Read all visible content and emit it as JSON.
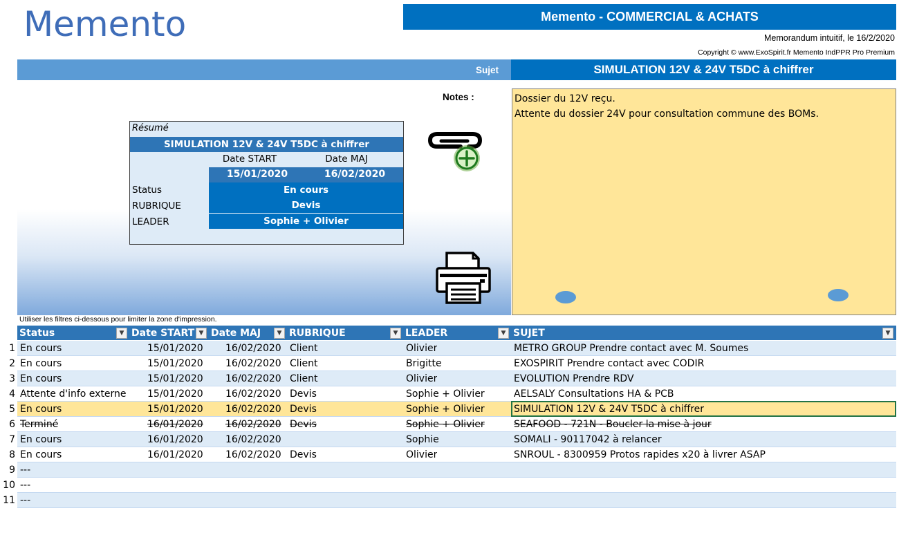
{
  "logo": "Memento",
  "app_title": "Memento - COMMERCIAL & ACHATS",
  "memo_date": "Memorandum intuitif, le 16/2/2020",
  "copyright": "Copyright © www.ExoSpirit.fr Memento IndPPR Pro Premium",
  "sujet": {
    "label": "Sujet",
    "value": "SIMULATION 12V & 24V T5DC à chiffrer"
  },
  "notes": {
    "label": "Notes  :",
    "lines": [
      "Dossier du 12V reçu.",
      "Attente du dossier 24V pour consultation commune des BOMs."
    ]
  },
  "resume": {
    "title": "Résumé",
    "subject": "SIMULATION 12V & 24V T5DC à chiffrer",
    "date_start_label": "Date START",
    "date_maj_label": "Date MAJ",
    "date_start": "15/01/2020",
    "date_maj": "16/02/2020",
    "status_label": "Status",
    "status": "En cours",
    "rubrique_label": "RUBRIQUE",
    "rubrique": "Devis",
    "leader_label": "LEADER",
    "leader": "Sophie + Olivier"
  },
  "icons": {
    "attach": "paperclip-add-icon",
    "print": "printer-icon"
  },
  "hint": "Utiliser les filtres ci-dessous pour limiter la zone d'impression.",
  "table": {
    "headers": {
      "status": "Status",
      "date_start": "Date START",
      "date_maj": "Date MAJ",
      "rubrique": "RUBRIQUE",
      "leader": "LEADER",
      "sujet": "SUJET"
    },
    "rows": [
      {
        "n": "1",
        "status": "En cours",
        "start": "15/01/2020",
        "maj": "16/02/2020",
        "rubrique": "Client",
        "leader": "Olivier",
        "sujet": "METRO GROUP Prendre contact avec M. Soumes"
      },
      {
        "n": "2",
        "status": "En cours",
        "start": "15/01/2020",
        "maj": "16/02/2020",
        "rubrique": "Client",
        "leader": "Brigitte",
        "sujet": "EXOSPIRIT Prendre contact avec CODIR"
      },
      {
        "n": "3",
        "status": "En cours",
        "start": "15/01/2020",
        "maj": "16/02/2020",
        "rubrique": "Client",
        "leader": "Olivier",
        "sujet": "EVOLUTION Prendre RDV"
      },
      {
        "n": "4",
        "status": "Attente d'info externe",
        "start": "15/01/2020",
        "maj": "16/02/2020",
        "rubrique": "Devis",
        "leader": "Sophie + Olivier",
        "sujet": "AELSALY Consultations HA & PCB"
      },
      {
        "n": "5",
        "status": "En cours",
        "start": "15/01/2020",
        "maj": "16/02/2020",
        "rubrique": "Devis",
        "leader": "Sophie + Olivier",
        "sujet": "SIMULATION 12V & 24V T5DC à chiffrer"
      },
      {
        "n": "6",
        "status": "Terminé",
        "start": "16/01/2020",
        "maj": "16/02/2020",
        "rubrique": "Devis",
        "leader": "Sophie + Olivier",
        "sujet": "SEAFOOD - 721N - Boucler la mise à jour"
      },
      {
        "n": "7",
        "status": "En cours",
        "start": "16/01/2020",
        "maj": "16/02/2020",
        "rubrique": "",
        "leader": "Sophie",
        "sujet": "SOMALI - 90117042 à relancer"
      },
      {
        "n": "8",
        "status": "En cours",
        "start": "16/01/2020",
        "maj": "16/02/2020",
        "rubrique": "Devis",
        "leader": "Olivier",
        "sujet": "SNROUL - 8300959 Protos rapides x20 à livrer ASAP"
      },
      {
        "n": "9",
        "status": "---",
        "start": "",
        "maj": "",
        "rubrique": "",
        "leader": "",
        "sujet": ""
      },
      {
        "n": "10",
        "status": "---",
        "start": "",
        "maj": "",
        "rubrique": "",
        "leader": "",
        "sujet": ""
      },
      {
        "n": "11",
        "status": "---",
        "start": "",
        "maj": "",
        "rubrique": "",
        "leader": "",
        "sujet": ""
      }
    ],
    "selected_row": "5",
    "strike_row": "6"
  },
  "colors": {
    "header_blue": "#0070c0",
    "mid_blue": "#2e75b6",
    "light_blue": "#deebf7",
    "note_yellow": "#ffe699"
  }
}
